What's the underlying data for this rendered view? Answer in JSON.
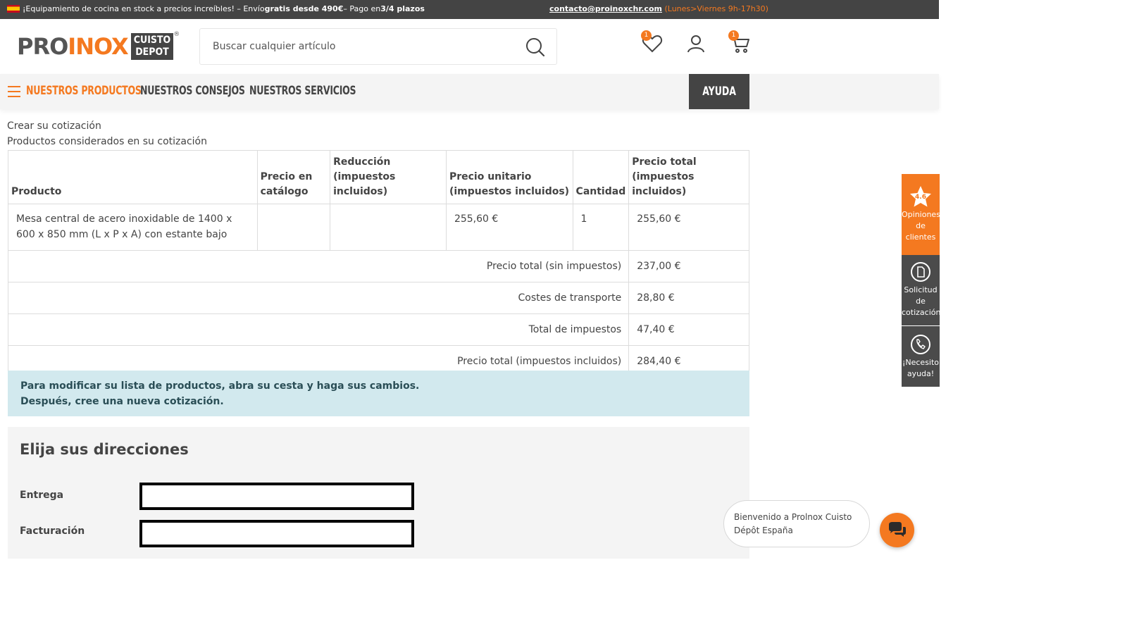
{
  "topbar": {
    "promo_pre": "¡Equipamiento de cocina en stock a precios increíbles! – Envío ",
    "promo_bold1": "gratis desde 490€",
    "promo_mid": " – Pago en ",
    "promo_bold2": "3/4 plazos",
    "contact_email": "contacto@proinoxchr.com",
    "contact_hours": "(Lunes>Viernes 9h-17h30)"
  },
  "header": {
    "logo_pro": "PRO",
    "logo_inox": "INOX",
    "logo_cd_1": "CUISTO",
    "logo_cd_2": "DEPOT",
    "logo_reg": "®",
    "search_placeholder": "Buscar cualquier artículo",
    "wishlist_count": "1",
    "cart_count": "1"
  },
  "nav": {
    "products": "NUESTROS PRODUCTOS",
    "advice": "NUESTROS CONSEJOS",
    "services": "NUESTROS SERVICIOS",
    "help": "AYUDA"
  },
  "page": {
    "breadcrumb_create": "Crear su cotización",
    "subtitle": "Productos considerados en su cotización"
  },
  "table": {
    "headers": [
      "Producto",
      "Precio en catálogo",
      "Reducción (impuestos incluidos)",
      "Precio unitario (impuestos incluidos)",
      "Cantidad",
      "Precio total (impuestos incluidos)"
    ],
    "rows": [
      {
        "product": "Mesa central de acero inoxidable de 1400 x 600 x 850 mm (L x P x A) con estante bajo",
        "catalog_price": "",
        "reduction": "",
        "unit_price": "255,60 €",
        "quantity": "1",
        "total": "255,60 €"
      }
    ],
    "summary": [
      {
        "label": "Precio total (sin impuestos)",
        "value": "237,00 €"
      },
      {
        "label": "Costes de transporte",
        "value": "28,80 €"
      },
      {
        "label": "Total de impuestos",
        "value": "47,40 €"
      },
      {
        "label": "Precio total (impuestos incluidos)",
        "value": "284,40 €"
      }
    ]
  },
  "alert": {
    "line1": "Para modificar su lista de productos, abra su cesta y haga sus cambios.",
    "line2": "Después, cree una nueva cotización."
  },
  "addresses": {
    "title": "Elija sus direcciones",
    "delivery_label": "Entrega",
    "billing_label": "Facturación"
  },
  "side": {
    "rating": "4.6",
    "reviews_1": "Opiniones",
    "reviews_2": "de",
    "reviews_3": "clientes",
    "quote_1": "Solicitud",
    "quote_2": "de",
    "quote_3": "cotización",
    "help_1": "¡Necesito",
    "help_2": "ayuda!"
  },
  "chat": {
    "welcome": "Bienvenido a Prolnox Cuisto Dépôt España"
  },
  "colors": {
    "brand_orange": "#f47920",
    "dark": "#444444",
    "alert_bg": "#d2e9ee"
  }
}
